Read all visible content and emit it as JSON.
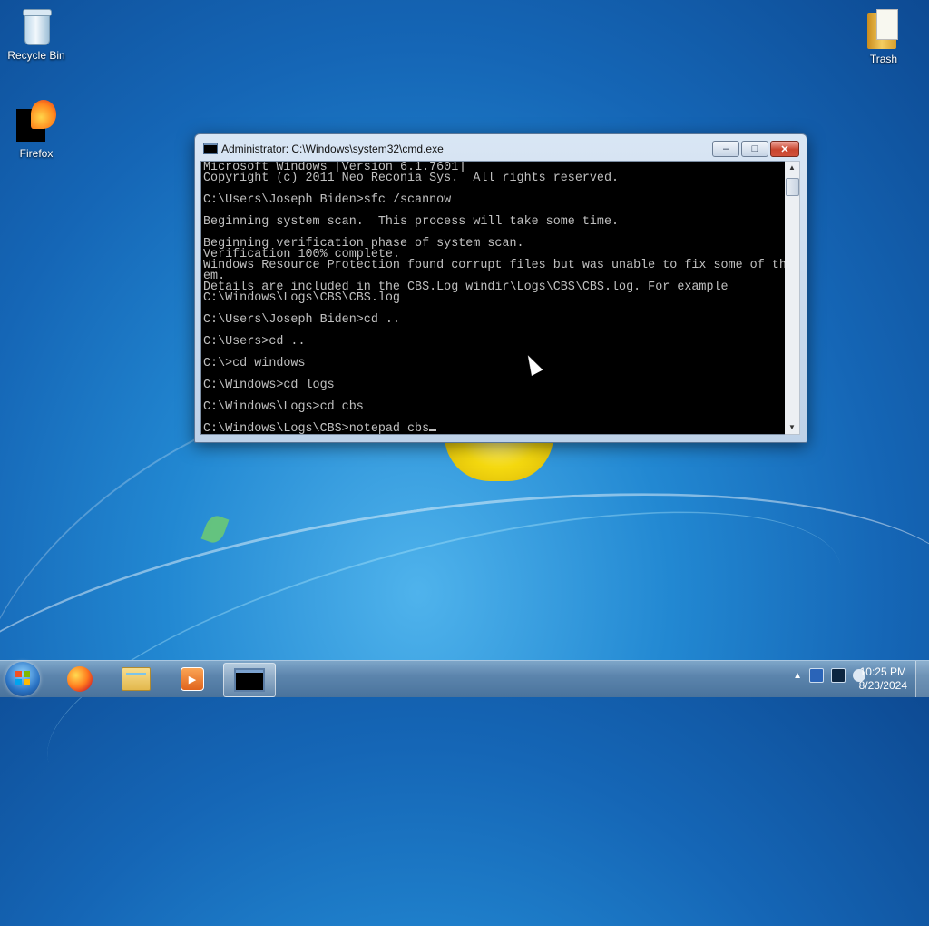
{
  "desktop": {
    "icons": [
      {
        "label": "Recycle Bin",
        "icon": "recycle-bin-icon"
      },
      {
        "label": "Firefox",
        "icon": "firefox-icon"
      },
      {
        "label": "Trash",
        "icon": "trash-folder-icon"
      }
    ]
  },
  "window": {
    "title": "Administrator: C:\\Windows\\system32\\cmd.exe",
    "buttons": {
      "minimize": "–",
      "maximize": "□",
      "close": "✕"
    },
    "console_lines": [
      "Microsoft Windows [Version 6.1.7601]",
      "Copyright (c) 2011 Neo Reconia Sys.  All rights reserved.",
      "",
      "C:\\Users\\Joseph Biden>sfc /scannow",
      "",
      "Beginning system scan.  This process will take some time.",
      "",
      "Beginning verification phase of system scan.",
      "Verification 100% complete.",
      "Windows Resource Protection found corrupt files but was unable to fix some of th",
      "em.",
      "Details are included in the CBS.Log windir\\Logs\\CBS\\CBS.log. For example",
      "C:\\Windows\\Logs\\CBS\\CBS.log",
      "",
      "C:\\Users\\Joseph Biden>cd ..",
      "",
      "C:\\Users>cd ..",
      "",
      "C:\\>cd windows",
      "",
      "C:\\Windows>cd logs",
      "",
      "C:\\Windows\\Logs>cd cbs",
      ""
    ],
    "input_line": "C:\\Windows\\Logs\\CBS>notepad cbs"
  },
  "taskbar": {
    "items": [
      "start-orb",
      "firefox-icon",
      "file-explorer-icon",
      "media-player-icon",
      "cmd-icon"
    ],
    "tray_expand": "▲",
    "clock_time": "10:25 PM",
    "clock_date": "8/23/2024"
  },
  "colors": {
    "console_bg": "#000000",
    "console_fg": "#c0c0c0",
    "close_red": "#c9452e"
  }
}
